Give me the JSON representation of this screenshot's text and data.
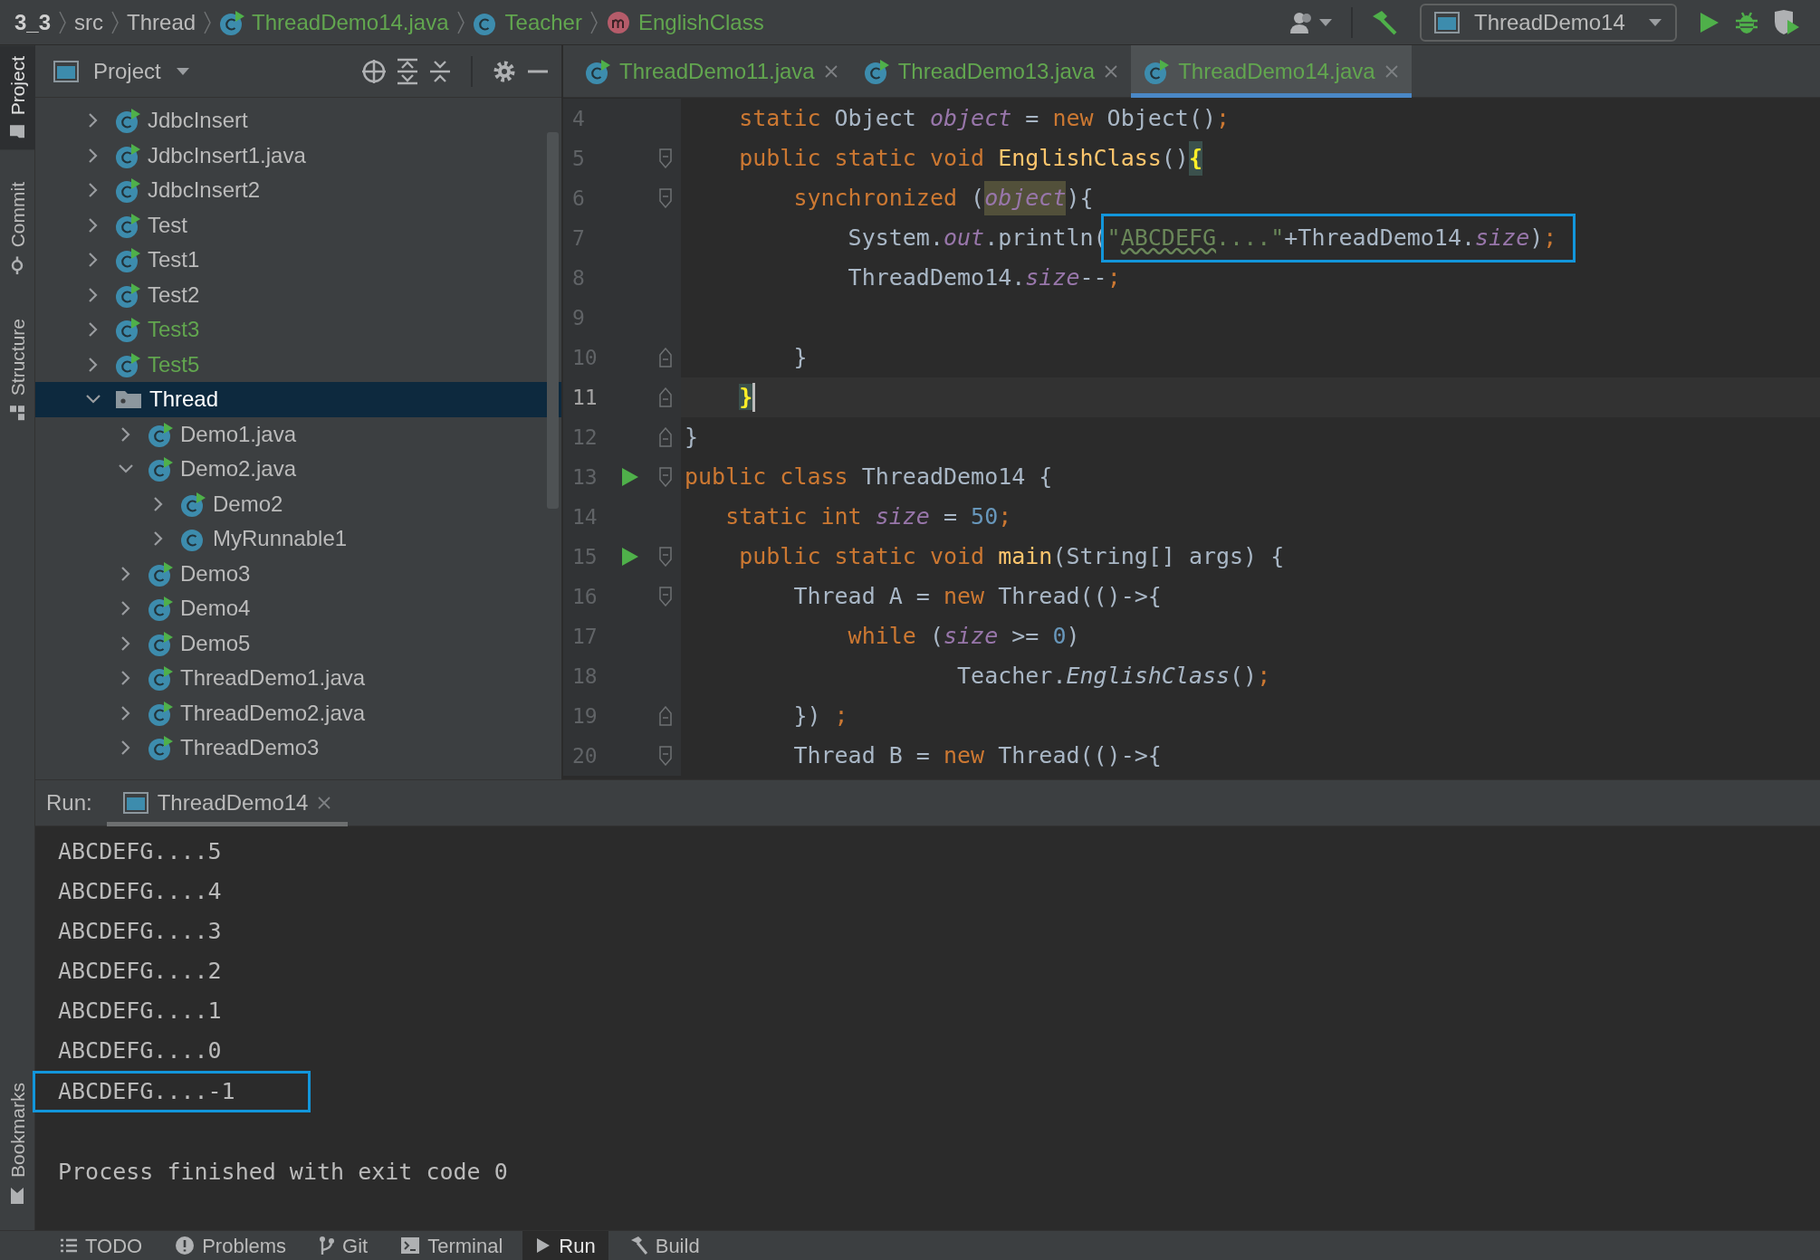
{
  "breadcrumbs": [
    {
      "label": "3_3",
      "kind": "project",
      "color": "#d0d0d0"
    },
    {
      "label": "src",
      "kind": "dir",
      "color": "#bbbbbb"
    },
    {
      "label": "Thread",
      "kind": "dir",
      "color": "#bbbbbb"
    },
    {
      "label": "ThreadDemo14.java",
      "kind": "class",
      "runnable": true,
      "color": "#62a64f"
    },
    {
      "label": "Teacher",
      "kind": "class",
      "runnable": false,
      "color": "#62a64f"
    },
    {
      "label": "EnglishClass",
      "kind": "method",
      "color": "#62a64f"
    }
  ],
  "run_config": {
    "label": "ThreadDemo14"
  },
  "left_stripe": {
    "top": [
      {
        "label": "Project",
        "kind": "project",
        "selected": true
      },
      {
        "label": "Commit",
        "kind": "commit",
        "selected": false
      },
      {
        "label": "Structure",
        "kind": "structure",
        "selected": false
      }
    ],
    "bottom": [
      {
        "label": "Bookmarks",
        "kind": "bookmarks",
        "selected": false
      }
    ]
  },
  "project_panel": {
    "title": "Project",
    "tree": [
      {
        "label": "JdbcInsert",
        "kind": "class",
        "runnable": true,
        "color": "#bbbbbb",
        "expanded": false,
        "selected": false
      },
      {
        "label": "JdbcInsert1.java",
        "kind": "class",
        "runnable": true,
        "color": "#bbbbbb",
        "expanded": false,
        "selected": false
      },
      {
        "label": "JdbcInsert2",
        "kind": "class",
        "runnable": true,
        "color": "#bbbbbb",
        "expanded": false,
        "selected": false
      },
      {
        "label": "Test",
        "kind": "class",
        "runnable": true,
        "color": "#bbbbbb",
        "expanded": false,
        "selected": false
      },
      {
        "label": "Test1",
        "kind": "class",
        "runnable": true,
        "color": "#bbbbbb",
        "expanded": false,
        "selected": false
      },
      {
        "label": "Test2",
        "kind": "class",
        "runnable": true,
        "color": "#bbbbbb",
        "expanded": false,
        "selected": false
      },
      {
        "label": "Test3",
        "kind": "class",
        "runnable": true,
        "color": "#62a64f",
        "expanded": false,
        "selected": false
      },
      {
        "label": "Test5",
        "kind": "class",
        "runnable": true,
        "color": "#62a64f",
        "expanded": false,
        "selected": false
      },
      {
        "label": "Thread",
        "kind": "folder",
        "expanded": true,
        "selected": true,
        "children": [
          {
            "label": "Demo1.java",
            "kind": "class",
            "runnable": true,
            "color": "#bbbbbb",
            "expanded": false,
            "selected": false
          },
          {
            "label": "Demo2.java",
            "kind": "class",
            "runnable": true,
            "color": "#bbbbbb",
            "expanded": true,
            "selected": false,
            "children": [
              {
                "label": "Demo2",
                "kind": "class",
                "runnable": true,
                "color": "#bbbbbb",
                "expanded": false,
                "selected": false
              },
              {
                "label": "MyRunnable1",
                "kind": "class",
                "runnable": false,
                "color": "#bbbbbb",
                "expanded": false,
                "selected": false
              }
            ]
          },
          {
            "label": "Demo3",
            "kind": "class",
            "runnable": true,
            "color": "#bbbbbb",
            "expanded": false,
            "selected": false
          },
          {
            "label": "Demo4",
            "kind": "class",
            "runnable": true,
            "color": "#bbbbbb",
            "expanded": false,
            "selected": false
          },
          {
            "label": "Demo5",
            "kind": "class",
            "runnable": true,
            "color": "#bbbbbb",
            "expanded": false,
            "selected": false
          },
          {
            "label": "ThreadDemo1.java",
            "kind": "class",
            "runnable": true,
            "color": "#bbbbbb",
            "expanded": false,
            "selected": false
          },
          {
            "label": "ThreadDemo2.java",
            "kind": "class",
            "runnable": true,
            "color": "#bbbbbb",
            "expanded": false,
            "selected": false
          },
          {
            "label": "ThreadDemo3",
            "kind": "class",
            "runnable": true,
            "color": "#bbbbbb",
            "expanded": false,
            "selected": false
          }
        ]
      }
    ]
  },
  "editor": {
    "tabs": [
      {
        "label": "ThreadDemo11.java",
        "selected": false
      },
      {
        "label": "ThreadDemo13.java",
        "selected": false
      },
      {
        "label": "ThreadDemo14.java",
        "selected": true
      }
    ],
    "lines": [
      {
        "number": "4",
        "current": false,
        "run": false,
        "kind": "plain",
        "tokens": [
          {
            "text": "    static",
            "kind": "kw"
          },
          {
            "text": " Object ",
            "kind": "plain"
          },
          {
            "text": "object",
            "kind": "field"
          },
          {
            "text": " = ",
            "kind": "plain"
          },
          {
            "text": "new",
            "kind": "kw"
          },
          {
            "text": " Object()",
            "kind": "plain"
          },
          {
            "text": ";",
            "kind": "kw"
          }
        ]
      },
      {
        "number": "5",
        "current": false,
        "run": false,
        "kind": "fold_start",
        "tokens": [
          {
            "text": "    public static void ",
            "kind": "kw"
          },
          {
            "text": "EnglishClass",
            "kind": "method"
          },
          {
            "text": "()",
            "kind": "plain"
          },
          {
            "text": "{",
            "kind": "brace"
          }
        ]
      },
      {
        "number": "6",
        "current": false,
        "run": false,
        "kind": "fold_start",
        "tokens": [
          {
            "text": "        synchronized ",
            "kind": "kw"
          },
          {
            "text": "(",
            "kind": "plain"
          },
          {
            "text": "object",
            "kind": "usage"
          },
          {
            "text": "){",
            "kind": "plain"
          }
        ]
      },
      {
        "number": "7",
        "current": false,
        "run": false,
        "kind": "plain",
        "tokens": [
          {
            "text": "            System.",
            "kind": "plain"
          },
          {
            "text": "out",
            "kind": "field"
          },
          {
            "text": ".println(",
            "kind": "plain"
          }
        ],
        "boxed_tokens": [
          {
            "text": "\"",
            "kind": "string"
          },
          {
            "text": "ABCDEFG",
            "kind": "typo"
          },
          {
            "text": "....\"",
            "kind": "string"
          },
          {
            "text": "+ThreadDemo14.",
            "kind": "plain"
          },
          {
            "text": "size",
            "kind": "field"
          },
          {
            "text": ")",
            "kind": "plain"
          },
          {
            "text": ";",
            "kind": "kw"
          }
        ]
      },
      {
        "number": "8",
        "current": false,
        "run": false,
        "kind": "plain",
        "tokens": [
          {
            "text": "            ThreadDemo14.",
            "kind": "plain"
          },
          {
            "text": "size",
            "kind": "field"
          },
          {
            "text": "--",
            "kind": "plain"
          },
          {
            "text": ";",
            "kind": "kw"
          }
        ]
      },
      {
        "number": "9",
        "current": false,
        "run": false,
        "kind": "plain"
      },
      {
        "number": "10",
        "current": false,
        "run": false,
        "kind": "fold_end",
        "tokens": [
          {
            "text": "        }",
            "kind": "plain"
          }
        ]
      },
      {
        "number": "11",
        "current": true,
        "run": false,
        "kind": "fold_end",
        "tokens": [
          {
            "text": "    }",
            "kind": "brace"
          }
        ]
      },
      {
        "number": "12",
        "current": false,
        "run": false,
        "kind": "fold_end",
        "tokens": [
          {
            "text": "}",
            "kind": "plain"
          }
        ]
      },
      {
        "number": "13",
        "current": false,
        "run": true,
        "kind": "fold_start",
        "tokens": [
          {
            "text": "public class ",
            "kind": "kw"
          },
          {
            "text": "ThreadDemo14 {",
            "kind": "plain"
          }
        ]
      },
      {
        "number": "14",
        "current": false,
        "run": false,
        "kind": "plain",
        "tokens": [
          {
            "text": "   static int ",
            "kind": "kw"
          },
          {
            "text": "size",
            "kind": "field"
          },
          {
            "text": " = ",
            "kind": "plain"
          },
          {
            "text": "50",
            "kind": "num"
          },
          {
            "text": ";",
            "kind": "kw"
          }
        ]
      },
      {
        "number": "15",
        "current": false,
        "run": true,
        "kind": "fold_start",
        "tokens": [
          {
            "text": "    public static void ",
            "kind": "kw"
          },
          {
            "text": "main",
            "kind": "method"
          },
          {
            "text": "(String[] args) {",
            "kind": "plain"
          }
        ]
      },
      {
        "number": "16",
        "current": false,
        "run": false,
        "kind": "fold_start",
        "tokens": [
          {
            "text": "        Thread A = ",
            "kind": "plain"
          },
          {
            "text": "new",
            "kind": "kw"
          },
          {
            "text": " Thread(()->{",
            "kind": "plain"
          }
        ]
      },
      {
        "number": "17",
        "current": false,
        "run": false,
        "kind": "plain",
        "tokens": [
          {
            "text": "            while ",
            "kind": "kw"
          },
          {
            "text": "(",
            "kind": "plain"
          },
          {
            "text": "size",
            "kind": "field"
          },
          {
            "text": " >= ",
            "kind": "plain"
          },
          {
            "text": "0",
            "kind": "num"
          },
          {
            "text": ")",
            "kind": "plain"
          }
        ]
      },
      {
        "number": "18",
        "current": false,
        "run": false,
        "kind": "plain",
        "tokens": [
          {
            "text": "                    Teacher.",
            "kind": "plain"
          },
          {
            "text": "EnglishClass",
            "kind": "static_call"
          },
          {
            "text": "()",
            "kind": "plain"
          },
          {
            "text": ";",
            "kind": "kw"
          }
        ]
      },
      {
        "number": "19",
        "current": false,
        "run": false,
        "kind": "fold_end",
        "tokens": [
          {
            "text": "        }) ",
            "kind": "plain"
          },
          {
            "text": ";",
            "kind": "kw"
          }
        ]
      },
      {
        "number": "20",
        "current": false,
        "run": false,
        "kind": "fold_start",
        "tokens": [
          {
            "text": "        Thread B = ",
            "kind": "plain"
          },
          {
            "text": "new",
            "kind": "kw"
          },
          {
            "text": " Thread(()->{",
            "kind": "plain"
          }
        ]
      }
    ]
  },
  "run_panel": {
    "label": "Run:",
    "tabs": [
      {
        "label": "ThreadDemo14",
        "selected": true
      }
    ],
    "console": [
      {
        "text": "ABCDEFG....5",
        "kind": "output",
        "boxed": false
      },
      {
        "text": "ABCDEFG....4",
        "kind": "output",
        "boxed": false
      },
      {
        "text": "ABCDEFG....3",
        "kind": "output",
        "boxed": false
      },
      {
        "text": "ABCDEFG....2",
        "kind": "output",
        "boxed": false
      },
      {
        "text": "ABCDEFG....1",
        "kind": "output",
        "boxed": false
      },
      {
        "text": "ABCDEFG....0",
        "kind": "output",
        "boxed": false
      },
      {
        "text": "ABCDEFG....-1",
        "kind": "output",
        "boxed": true
      },
      {
        "text": "Process finished with exit code 0",
        "kind": "exit",
        "boxed": false
      }
    ]
  },
  "bottom_bar": [
    {
      "label": "TODO",
      "kind": "todo",
      "selected": false
    },
    {
      "label": "Problems",
      "kind": "problems",
      "selected": false
    },
    {
      "label": "Git",
      "kind": "git",
      "selected": false
    },
    {
      "label": "Terminal",
      "kind": "terminal",
      "selected": false
    },
    {
      "label": "Run",
      "kind": "run",
      "selected": true
    },
    {
      "label": "Build",
      "kind": "build",
      "selected": false
    }
  ]
}
